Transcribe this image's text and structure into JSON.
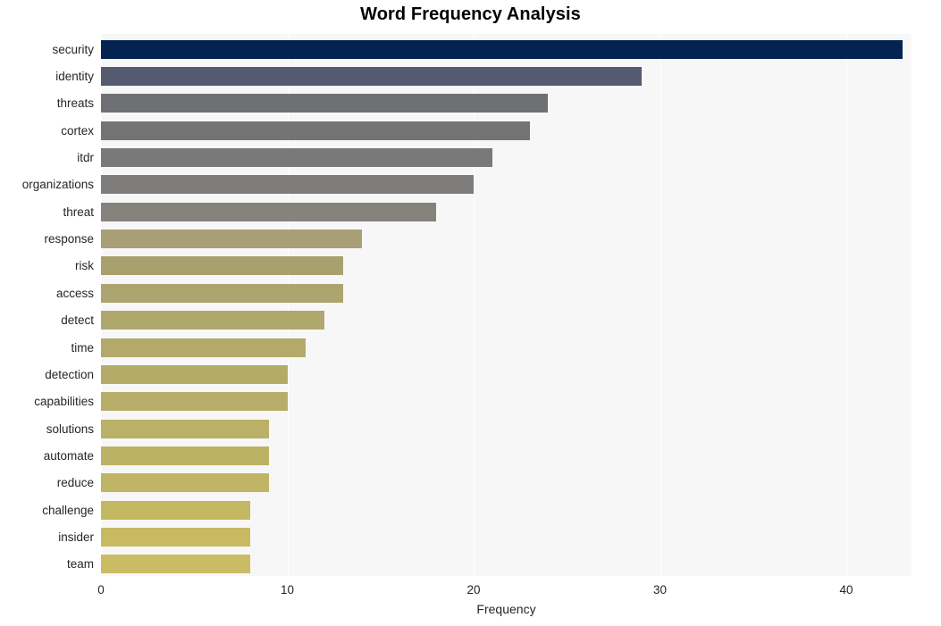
{
  "title": "Word Frequency Analysis",
  "axes": {
    "x_label": "Frequency",
    "y_label": "",
    "x_ticks": [
      "0",
      "10",
      "20",
      "30",
      "40"
    ]
  },
  "chart_data": {
    "type": "bar",
    "orientation": "horizontal",
    "title": "Word Frequency Analysis",
    "xlabel": "Frequency",
    "ylabel": "",
    "xlim": [
      0,
      43.5
    ],
    "xticks": [
      0,
      10,
      20,
      30,
      40
    ],
    "grid": true,
    "legend": "none",
    "categories": [
      "security",
      "identity",
      "threats",
      "cortex",
      "itdr",
      "organizations",
      "threat",
      "response",
      "risk",
      "access",
      "detect",
      "time",
      "detection",
      "capabilities",
      "solutions",
      "automate",
      "reduce",
      "challenge",
      "insider",
      "team"
    ],
    "values": [
      43,
      29,
      24,
      23,
      21,
      20,
      18,
      14,
      13,
      13,
      12,
      11,
      10,
      10,
      9,
      9,
      9,
      8,
      8,
      8
    ],
    "bar_colors": [
      "#042351",
      "#545b70",
      "#6e7073",
      "#737476",
      "#79797a",
      "#7e7d7b",
      "#85837c",
      "#a89f76",
      "#a9a070",
      "#ada46f",
      "#b0a76d",
      "#b2a96b",
      "#b4ab69",
      "#b6ad68",
      "#bab067",
      "#bcb265",
      "#bfb564",
      "#c4b862",
      "#c7ba62",
      "#c9bc63"
    ],
    "plot_background": "#f7f7f8",
    "gridline_color": "#ffffff",
    "figure_background": "#ffffff"
  }
}
